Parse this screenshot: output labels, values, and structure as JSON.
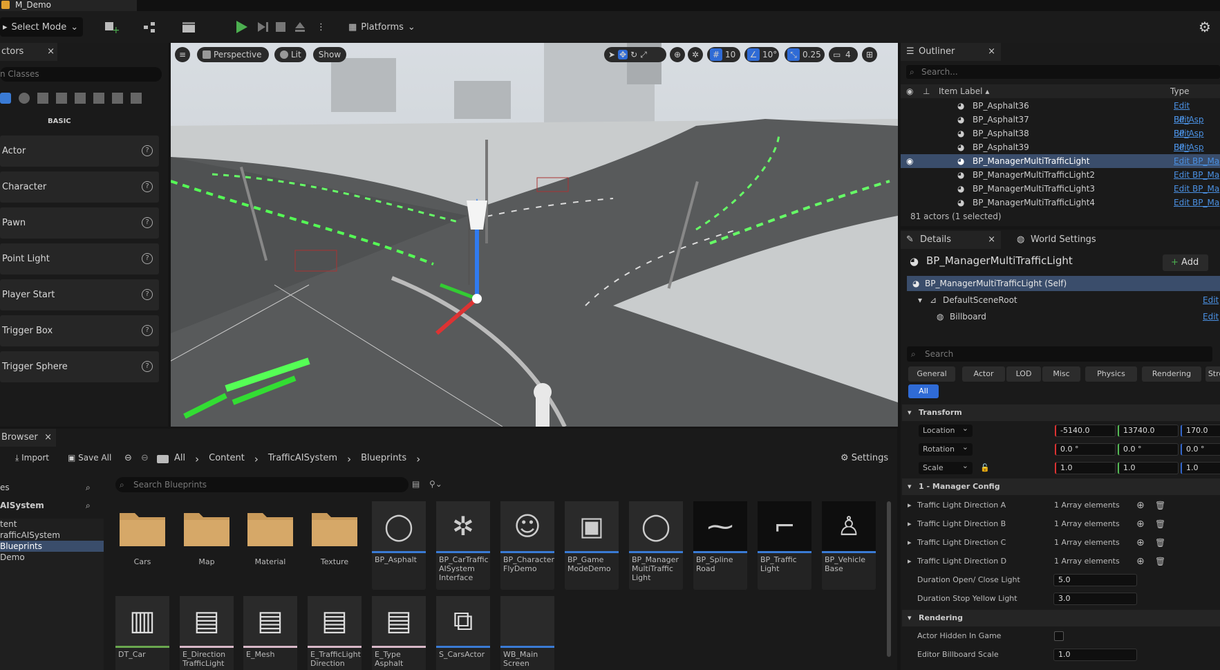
{
  "window": {
    "tab_title": "M_Demo"
  },
  "toolbar": {
    "select_mode": "Select Mode",
    "platforms": "Platforms"
  },
  "place_actors": {
    "tab": "ctors",
    "search_placeholder": "n Classes",
    "category": "BASIC",
    "items": [
      "Actor",
      "Character",
      "Pawn",
      "Point Light",
      "Player Start",
      "Trigger Box",
      "Trigger Sphere"
    ]
  },
  "viewport": {
    "perspective": "Perspective",
    "lit": "Lit",
    "show": "Show",
    "grid_snap": "10",
    "rot_snap": "10°",
    "scale_snap": "0.25",
    "camera_speed": "4"
  },
  "outliner": {
    "tab": "Outliner",
    "search_placeholder": "Search...",
    "col_label": "Item Label ▴",
    "col_type": "Type",
    "rows": [
      {
        "label": "BP_Asphalt36",
        "type": "Edit BP_Asp"
      },
      {
        "label": "BP_Asphalt37",
        "type": "Edit BP_Asp"
      },
      {
        "label": "BP_Asphalt38",
        "type": "Edit BP_Asp"
      },
      {
        "label": "BP_Asphalt39",
        "type": "Edit BP_Asp"
      },
      {
        "label": "BP_ManagerMultiTrafficLight",
        "type": "Edit BP_Ma"
      },
      {
        "label": "BP_ManagerMultiTrafficLight2",
        "type": "Edit BP_Ma"
      },
      {
        "label": "BP_ManagerMultiTrafficLight3",
        "type": "Edit BP_Ma"
      },
      {
        "label": "BP_ManagerMultiTrafficLight4",
        "type": "Edit BP_Ma"
      }
    ],
    "status": "81 actors (1 selected)"
  },
  "details": {
    "tab": "Details",
    "tab2": "World Settings",
    "actor_name": "BP_ManagerMultiTrafficLight",
    "add": "Add",
    "components": {
      "self": "BP_ManagerMultiTrafficLight (Self)",
      "root": "DefaultSceneRoot",
      "billboard": "Billboard",
      "edit": "Edit"
    },
    "search_placeholder": "Search",
    "filters": [
      "General",
      "Actor",
      "LOD",
      "Misc",
      "Physics",
      "Rendering",
      "Stre"
    ],
    "all": "All",
    "transform": {
      "title": "Transform",
      "location": {
        "label": "Location",
        "x": "-5140.0",
        "y": "13740.0",
        "z": "170.0"
      },
      "rotation": {
        "label": "Rotation",
        "x": "0.0 °",
        "y": "0.0 °",
        "z": "0.0 °"
      },
      "scale": {
        "label": "Scale",
        "x": "1.0",
        "y": "1.0",
        "z": "1.0"
      }
    },
    "manager": {
      "title": "1 - Manager Config",
      "arrays": [
        {
          "label": "Traffic Light Direction A",
          "value": "1 Array elements"
        },
        {
          "label": "Traffic Light Direction B",
          "value": "1 Array elements"
        },
        {
          "label": "Traffic Light Direction C",
          "value": "1 Array elements"
        },
        {
          "label": "Traffic Light Direction D",
          "value": "1 Array elements"
        }
      ],
      "duration_open": {
        "label": "Duration Open/ Close Light",
        "value": "5.0"
      },
      "duration_stop": {
        "label": "Duration Stop Yellow Light",
        "value": "3.0"
      }
    },
    "rendering": {
      "title": "Rendering",
      "hidden": {
        "label": "Actor Hidden In Game"
      },
      "billboard_scale": {
        "label": "Editor Billboard Scale",
        "value": "1.0"
      }
    }
  },
  "content_browser": {
    "tab": "Browser",
    "import": "Import",
    "save_all": "Save All",
    "breadcrumb": [
      "All",
      "Content",
      "TrafficAISystem",
      "Blueprints"
    ],
    "settings": "Settings",
    "tree_header1": "es",
    "tree_header2": "AISystem",
    "tree": [
      "tent",
      "rafficAISystem",
      "Blueprints",
      "Demo"
    ],
    "search_placeholder": "Search Blueprints",
    "folders": [
      "Cars",
      "Map",
      "Material",
      "Texture"
    ],
    "assets_row1": [
      "BP_Asphalt",
      "BP_CarTraffic AISystem Interface",
      "BP_Character FlyDemo",
      "BP_Game ModeDemo",
      "BP_Manager MultiTraffic Light",
      "BP_Spline Road",
      "BP_Traffic Light",
      "BP_Vehicle Base"
    ],
    "assets_row2": [
      "DT_Car",
      "E_Direction TrafficLight",
      "E_Mesh",
      "E_TrafficLight Direction",
      "E_Type Asphalt",
      "S_CarsActor",
      "WB_Main Screen"
    ]
  }
}
